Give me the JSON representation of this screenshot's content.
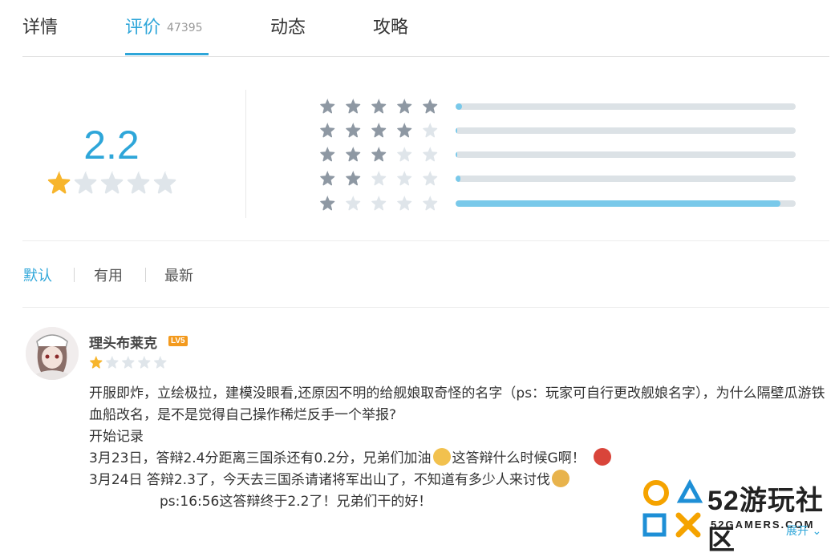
{
  "tabs": [
    {
      "label": "详情"
    },
    {
      "label": "评价",
      "count": "47395"
    },
    {
      "label": "动态"
    },
    {
      "label": "攻略"
    }
  ],
  "rating": {
    "score": "2.2",
    "stars_filled": 1,
    "stars_total": 5,
    "distribution": [
      {
        "stars": 5,
        "fraction": 0.02
      },
      {
        "stars": 4,
        "fraction": 0.005
      },
      {
        "stars": 3,
        "fraction": 0.005
      },
      {
        "stars": 2,
        "fraction": 0.015
      },
      {
        "stars": 1,
        "fraction": 0.955
      }
    ]
  },
  "sort": {
    "default": "默认",
    "useful": "有用",
    "latest": "最新"
  },
  "review": {
    "username": "理头布莱克",
    "level": "LV5",
    "stars": 1,
    "lines": [
      "开服即炸，立绘极拉，建模没眼看,还原因不明的给舰娘取奇怪的名字（ps：玩家可自行更改舰娘名字），为什么隔壁瓜游铁血船改名，是不是觉得自己操作稀烂反手一个举报?",
      "开始记录",
      "3月23日，答辩2.4分距离三国杀还有0.2分，兄弟们加油",
      "这答辩什么时候G啊！",
      "3月24日  答辩2.3了，今天去三国杀请诸将军出山了，不知道有多少人来讨伐",
      "ps:16:56这答辩终于2.2了！兄弟们干的好！"
    ],
    "expand": "展开"
  },
  "watermark": {
    "title": "52游玩社区",
    "subtitle": "52GAMERS.COM"
  },
  "colors": {
    "accent": "#2ea6d9",
    "star_gold": "#f7b52c",
    "star_gray": "#8e98a3",
    "star_light": "#dfe5ea",
    "bar_fill": "#79c9ea"
  }
}
